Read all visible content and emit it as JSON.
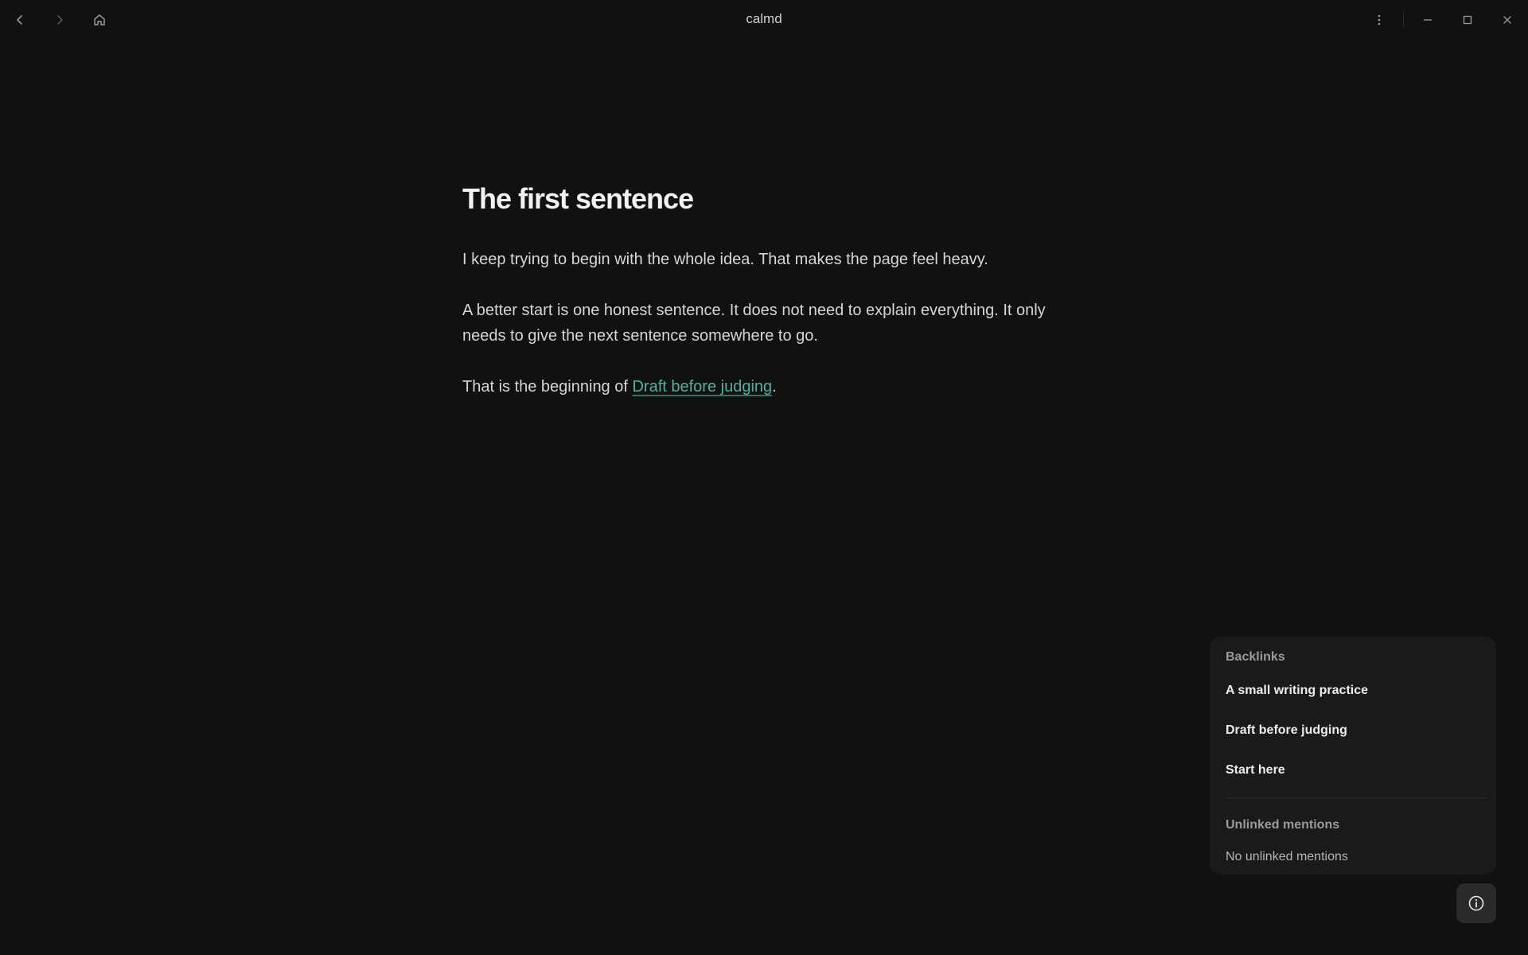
{
  "window": {
    "title": "calmd"
  },
  "icons": {
    "back": "chevron-left-icon",
    "forward": "chevron-right-icon",
    "home": "home-icon",
    "menu": "more-vertical-icon",
    "minimize": "minimize-icon",
    "maximize": "maximize-icon",
    "close": "close-icon",
    "info": "info-icon"
  },
  "document": {
    "title": "The first sentence",
    "paragraphs": [
      "I keep trying to begin with the whole idea. That makes the page feel heavy.",
      "A better start is one honest sentence. It does not need to explain everything. It only needs to give the next sentence somewhere to go."
    ],
    "last_paragraph": {
      "prefix": "That is the beginning of ",
      "link": "Draft before judging",
      "suffix": "."
    }
  },
  "panel": {
    "backlinks_heading": "Backlinks",
    "backlinks": [
      "A small writing practice",
      "Draft before judging",
      "Start here"
    ],
    "unlinked_heading": "Unlinked mentions",
    "unlinked_empty": "No unlinked mentions"
  },
  "colors": {
    "background": "#111111",
    "panel": "#1a1a1a",
    "link": "#4eb3a3"
  }
}
